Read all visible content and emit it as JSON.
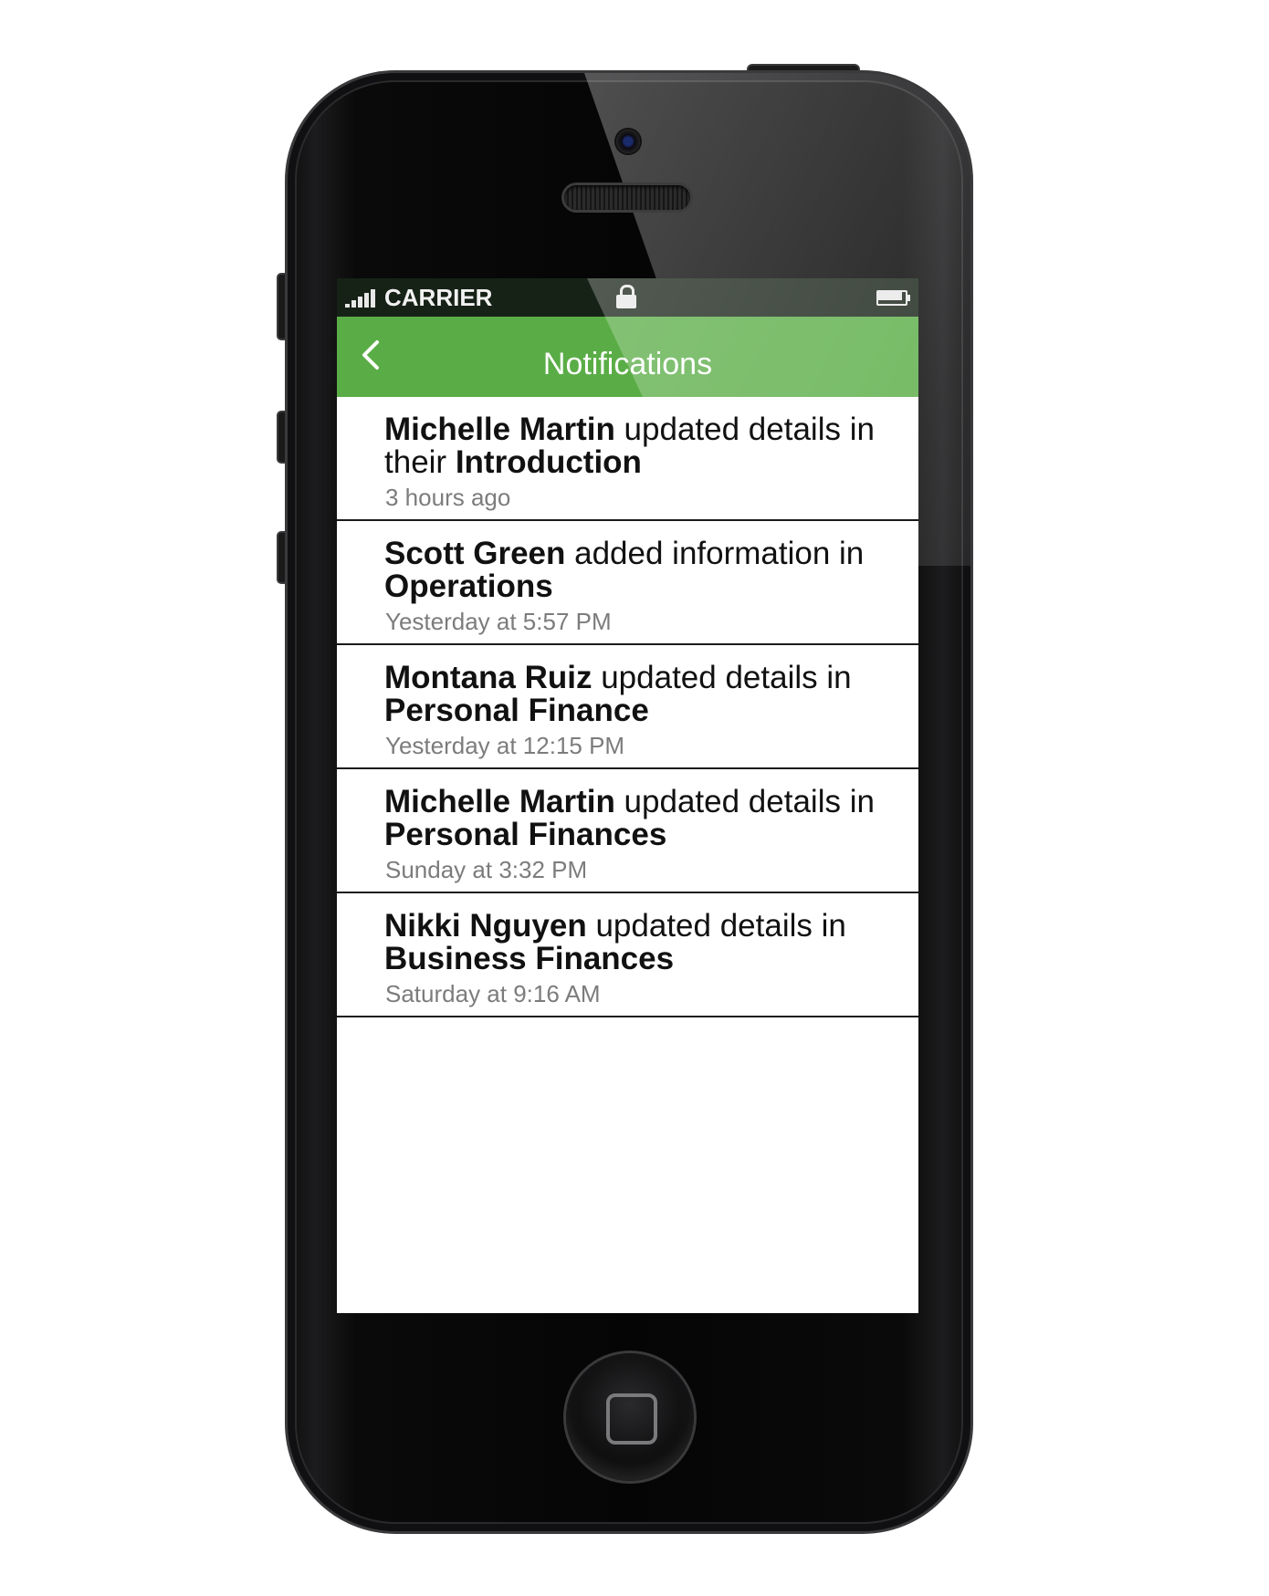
{
  "status_bar": {
    "carrier": "CARRIER",
    "signal_icon": "signal-bars-icon",
    "lock_icon": "lock-icon",
    "battery_icon": "battery-icon"
  },
  "nav": {
    "title": "Notifications",
    "back_icon": "chevron-left-icon"
  },
  "colors": {
    "nav_green": "#5aad46",
    "status_bar_bg": "#172217",
    "timestamp_gray": "#7c7c7c"
  },
  "notifications": [
    {
      "actor": "Michelle Martin",
      "action": " updated details in their ",
      "target": "Introduction",
      "time": "3 hours ago"
    },
    {
      "actor": "Scott Green",
      "action": " added information in ",
      "target": "Operations",
      "time": "Yesterday at 5:57 PM"
    },
    {
      "actor": "Montana Ruiz",
      "action": " updated details in ",
      "target": "Personal Finance",
      "time": "Yesterday at 12:15 PM"
    },
    {
      "actor": "Michelle Martin",
      "action": " updated details in ",
      "target": "Personal Finances",
      "time": "Sunday at 3:32 PM"
    },
    {
      "actor": "Nikki Nguyen",
      "action": " updated details in ",
      "target": "Business Finances",
      "time": "Saturday at 9:16 AM"
    }
  ]
}
